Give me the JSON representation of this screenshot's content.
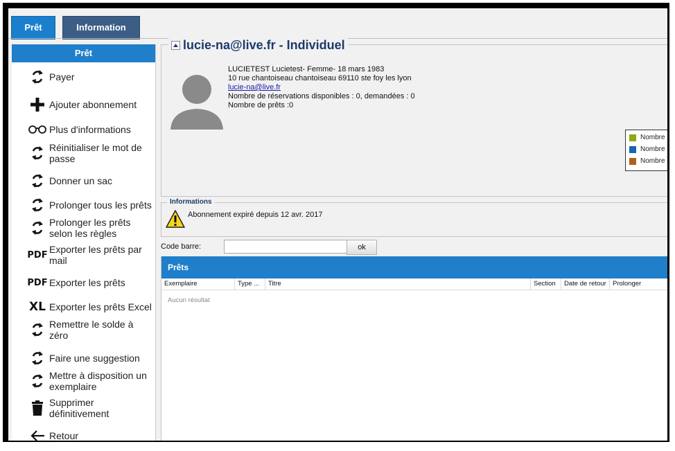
{
  "tabs": [
    {
      "label": "Prêt"
    },
    {
      "label": "Information"
    }
  ],
  "sidebar": {
    "header": "Prêt",
    "items": [
      {
        "label": "Payer",
        "icon": "refresh-icon"
      },
      {
        "label": "Ajouter abonnement",
        "icon": "plus-icon"
      },
      {
        "label": "Plus d'informations",
        "icon": "glasses-icon"
      },
      {
        "label": "Réinitialiser le mot de passe",
        "icon": "refresh-icon"
      },
      {
        "label": "Donner un sac",
        "icon": "refresh-icon"
      },
      {
        "label": "Prolonger tous les prêts",
        "icon": "refresh-icon"
      },
      {
        "label": "Prolonger les prêts selon les règles",
        "icon": "refresh-icon"
      },
      {
        "label": "Exporter les prêts par mail",
        "icon": "pdf-icon",
        "icon_text": "PDF"
      },
      {
        "label": "Exporter les prêts",
        "icon": "pdf-icon",
        "icon_text": "PDF"
      },
      {
        "label": "Exporter les prêts Excel",
        "icon": "excel-icon",
        "icon_text": "XL"
      },
      {
        "label": "Remettre le solde à zéro",
        "icon": "refresh-icon"
      },
      {
        "label": "Faire une suggestion",
        "icon": "refresh-icon"
      },
      {
        "label": "Mettre à disposition un exemplaire",
        "icon": "refresh-icon"
      },
      {
        "label": "Supprimer définitivement",
        "icon": "trash-icon"
      },
      {
        "label": "Retour",
        "icon": "arrow-left-icon"
      }
    ]
  },
  "user": {
    "title": "lucie-na@live.fr - Individuel",
    "line1": "LUCIETEST Lucietest- Femme- 18 mars 1983",
    "line2": "10 rue chantoiseau chantoiseau 69110 ste foy les lyon",
    "email": "lucie-na@live.fr",
    "reservations": "Nombre de réservations disponibles : 0, demandées : 0",
    "loans_count": "Nombre de prêts :0"
  },
  "legend": {
    "items": [
      {
        "label": "Nombre",
        "color": "#8aab12"
      },
      {
        "label": "Nombre",
        "color": "#1565b8"
      },
      {
        "label": "Nombre",
        "color": "#b0601a"
      }
    ]
  },
  "informations": {
    "title": "Informations",
    "message": "Abonnement expiré depuis 12 avr. 2017"
  },
  "barcode": {
    "label": "Code barre:",
    "value": "",
    "button": "ok"
  },
  "loans_table": {
    "title": "Prêts",
    "columns": [
      "Exemplaire",
      "Type ...",
      "Titre",
      "Section",
      "Date de retour",
      "Prolonger"
    ],
    "empty_text": "Aucun résultat"
  },
  "colors": {
    "accent": "#1f7fcb",
    "tab_info": "#3c5d86",
    "title": "#1b3a6b",
    "background": "#f1f1f1"
  }
}
